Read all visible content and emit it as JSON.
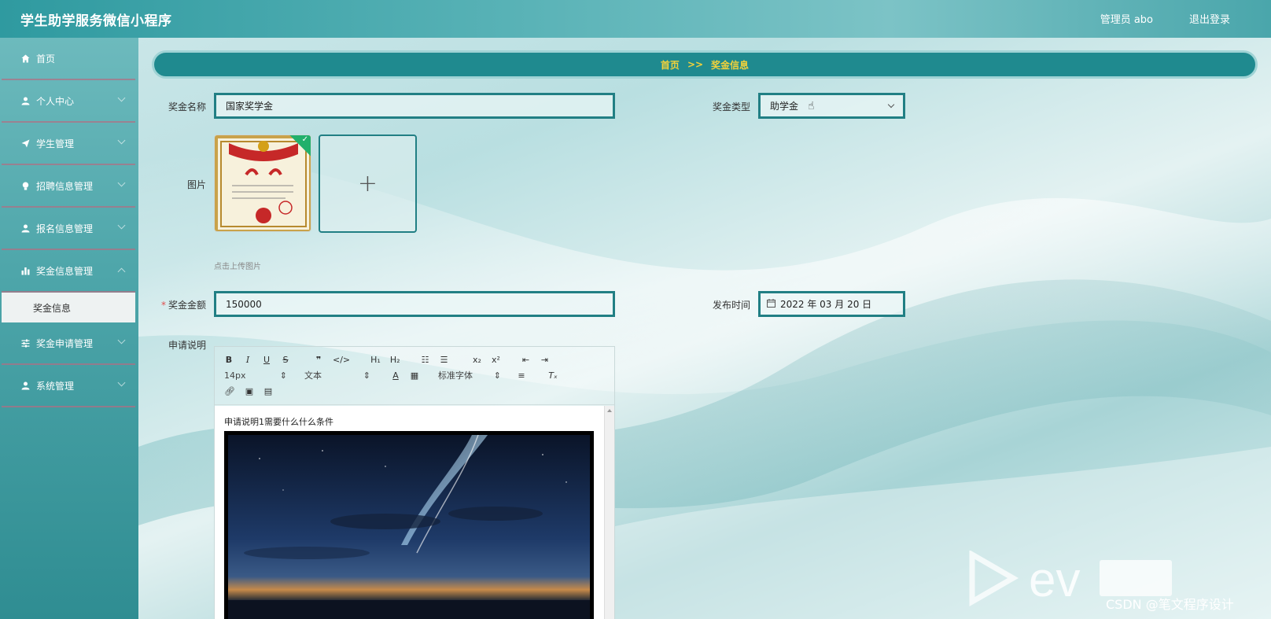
{
  "header": {
    "title": "学生助学服务微信小程序",
    "user": "管理员 abo",
    "logout": "退出登录"
  },
  "sidebar": {
    "items": [
      {
        "label": "首页",
        "icon": "home-icon"
      },
      {
        "label": "个人中心",
        "icon": "user-icon"
      },
      {
        "label": "学生管理",
        "icon": "send-icon"
      },
      {
        "label": "招聘信息管理",
        "icon": "bulb-icon"
      },
      {
        "label": "报名信息管理",
        "icon": "user-icon"
      },
      {
        "label": "奖金信息管理",
        "icon": "chart-icon"
      },
      {
        "label": "奖金申请管理",
        "icon": "sliders-icon"
      },
      {
        "label": "系统管理",
        "icon": "user-icon"
      }
    ],
    "active_sub": "奖金信息"
  },
  "breadcrumb": {
    "home": "首页",
    "sep": ">>",
    "current": "奖金信息"
  },
  "form": {
    "name_label": "奖金名称",
    "name_value": "国家奖学金",
    "type_label": "奖金类型",
    "type_value": "助学金",
    "image_label": "图片",
    "upload_hint": "点击上传图片",
    "amount_label": "奖金金额",
    "amount_value": "150000",
    "date_label": "发布时间",
    "date_value": "2022 年 03 月 20 日",
    "desc_label": "申请说明"
  },
  "editor": {
    "font_size": "14px",
    "block_type": "文本",
    "font_family": "标准字体",
    "content_text": "申请说明1需要什么什么条件"
  },
  "watermark": {
    "text": "CSDN @笔文程序设计"
  },
  "colors": {
    "accent": "#217f84",
    "breadcrumb_text": "#f3d23a"
  }
}
